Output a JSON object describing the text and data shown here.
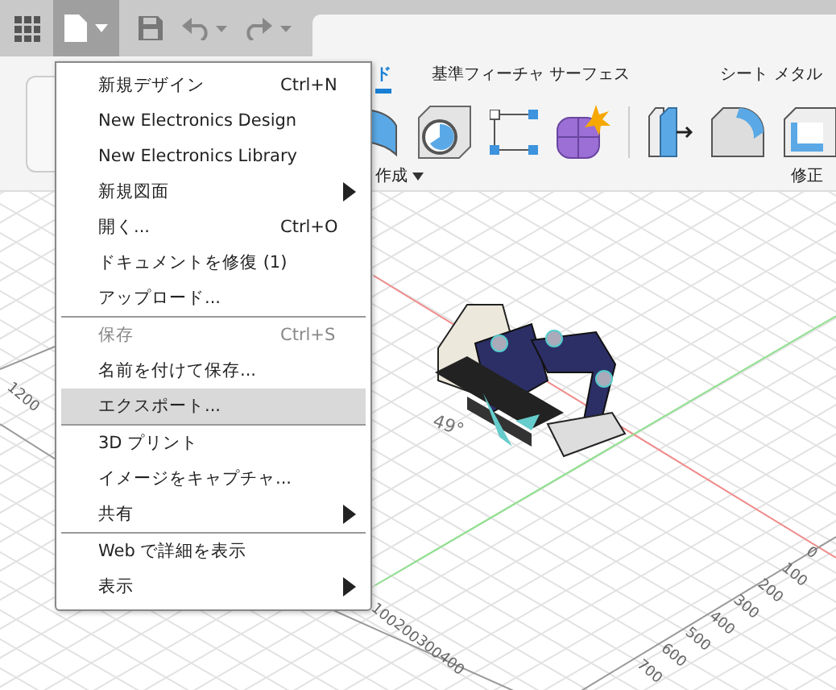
{
  "ribbon": {
    "tabs": [
      {
        "label": "ド",
        "selected": true
      },
      {
        "label": "基準フィーチャ サーフェス",
        "selected": false
      },
      {
        "label": "シート メタル",
        "selected": false
      }
    ],
    "groups": [
      {
        "label": "作成",
        "dropdown": true
      },
      {
        "label": "修正",
        "dropdown": false
      }
    ]
  },
  "file_menu": {
    "open": true,
    "items": [
      {
        "kind": "item",
        "label": "新規デザイン",
        "shortcut": "Ctrl+N",
        "submenu": false,
        "disabled": false,
        "selected": false
      },
      {
        "kind": "item",
        "label": "New Electronics Design",
        "submenu": false,
        "disabled": false,
        "selected": false
      },
      {
        "kind": "item",
        "label": "New Electronics Library",
        "submenu": false,
        "disabled": false,
        "selected": false
      },
      {
        "kind": "item",
        "label": "新規図面",
        "submenu": true,
        "disabled": false,
        "selected": false
      },
      {
        "kind": "item",
        "label": "開く...",
        "shortcut": "Ctrl+O",
        "submenu": false,
        "disabled": false,
        "selected": false
      },
      {
        "kind": "item",
        "label": "ドキュメントを修復 (1)",
        "submenu": false,
        "disabled": false,
        "selected": false
      },
      {
        "kind": "item",
        "label": "アップロード...",
        "submenu": false,
        "disabled": false,
        "selected": false
      },
      {
        "kind": "separator"
      },
      {
        "kind": "item",
        "label": "保存",
        "shortcut": "Ctrl+S",
        "submenu": false,
        "disabled": true,
        "selected": false
      },
      {
        "kind": "item",
        "label": "名前を付けて保存...",
        "submenu": false,
        "disabled": false,
        "selected": false
      },
      {
        "kind": "item",
        "label": "エクスポート...",
        "submenu": false,
        "disabled": false,
        "selected": true
      },
      {
        "kind": "separator"
      },
      {
        "kind": "item",
        "label": "3D プリント",
        "submenu": false,
        "disabled": false,
        "selected": false
      },
      {
        "kind": "item",
        "label": "イメージをキャプチャ...",
        "submenu": false,
        "disabled": false,
        "selected": false
      },
      {
        "kind": "item",
        "label": "共有",
        "submenu": true,
        "disabled": false,
        "selected": false
      },
      {
        "kind": "separator"
      },
      {
        "kind": "item",
        "label": "Web で詳細を表示",
        "submenu": false,
        "disabled": false,
        "selected": false
      },
      {
        "kind": "item",
        "label": "表示",
        "submenu": true,
        "disabled": false,
        "selected": false
      }
    ]
  },
  "viewport": {
    "angle_label": "49°",
    "left_axis_labels": [
      "1200"
    ],
    "bottom_axis_labels": [
      "100",
      "200",
      "300",
      "400"
    ],
    "right_axis_labels": [
      "0",
      "100",
      "200",
      "300",
      "400",
      "500",
      "600",
      "700"
    ]
  }
}
